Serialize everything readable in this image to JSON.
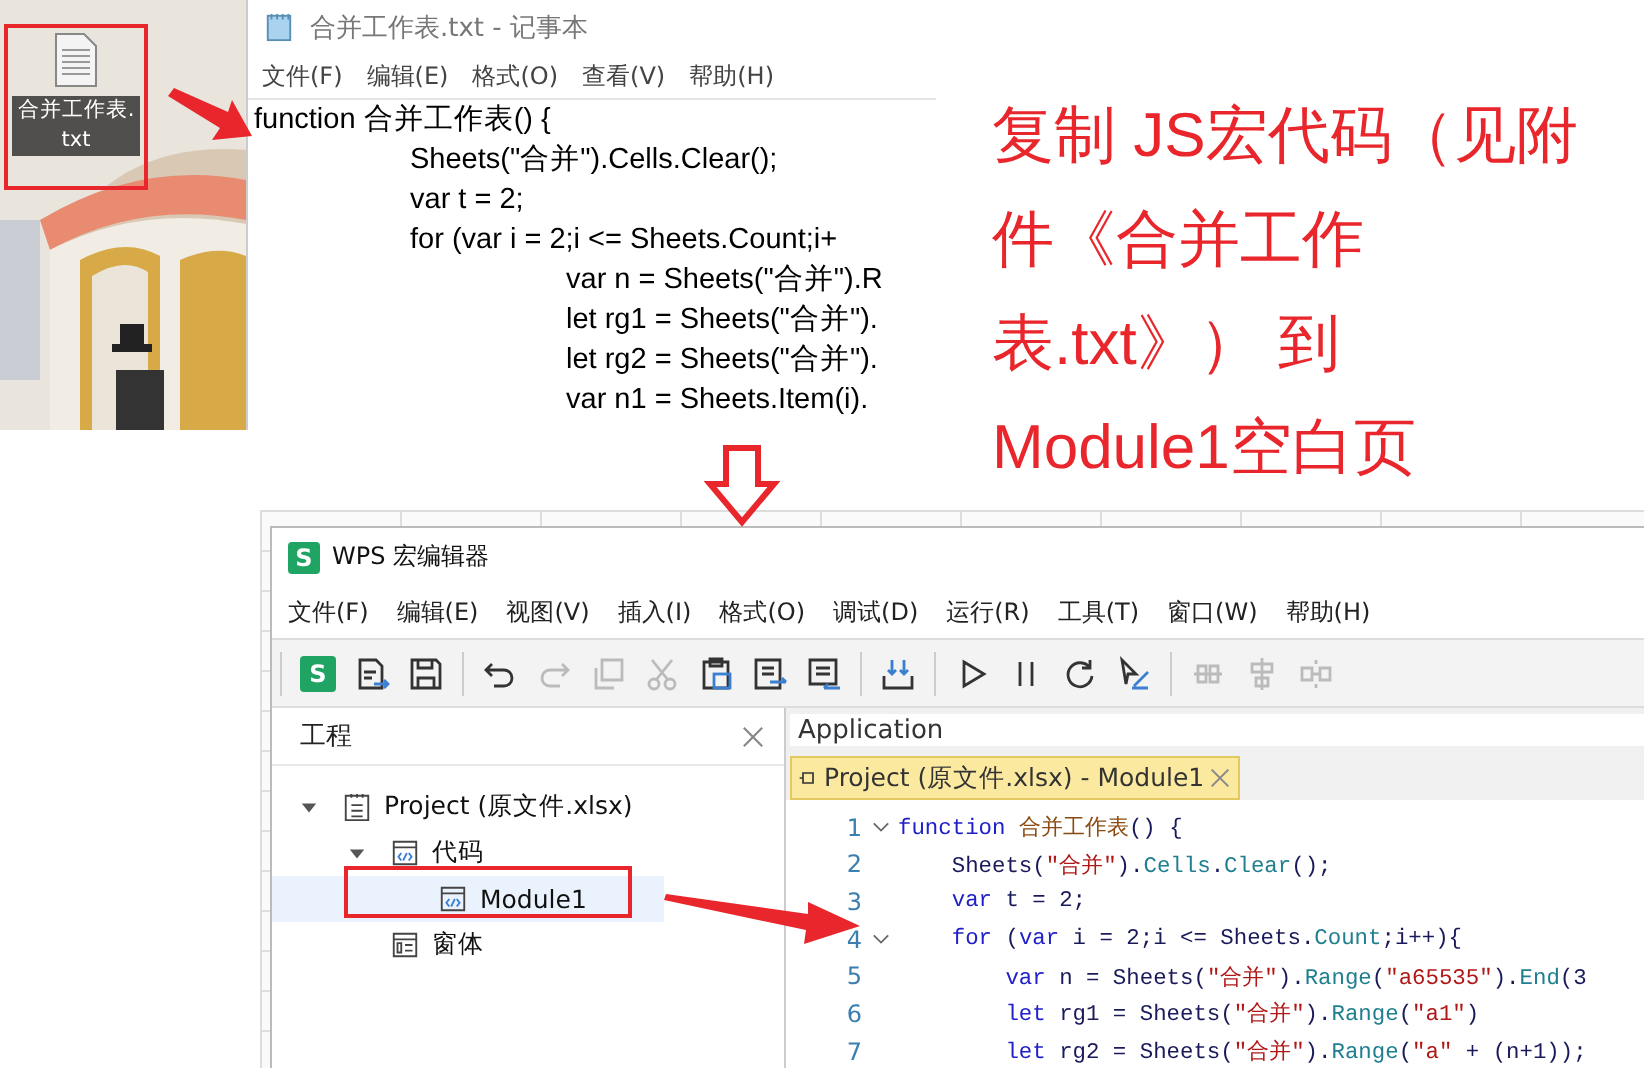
{
  "desktop": {
    "file_label": "合并工作表.txt"
  },
  "notepad": {
    "title": "合并工作表.txt - 记事本",
    "menu": [
      "文件(F)",
      "编辑(E)",
      "格式(O)",
      "查看(V)",
      "帮助(H)"
    ],
    "lines": [
      "function 合并工作表() {",
      "\t\tSheets(\"合并\").Cells.Clear();",
      "\t\tvar t = 2;",
      "\t\tfor (var i = 2;i <= Sheets.Count;i+",
      "\t\t\t\tvar n = Sheets(\"合并\").R",
      "\t\t\t\tlet rg1 = Sheets(\"合并\").",
      "\t\t\t\tlet rg2 = Sheets(\"合并\").",
      "\t\t\t\tvar n1 = Sheets.Item(i)."
    ]
  },
  "annotation": "复制 JS宏代码（见附件《合并工作表.txt》） 到 Module1空白页",
  "editor": {
    "logo_letter": "S",
    "title": "WPS 宏编辑器",
    "menu": [
      "文件(F)",
      "编辑(E)",
      "视图(V)",
      "插入(I)",
      "格式(O)",
      "调试(D)",
      "运行(R)",
      "工具(T)",
      "窗口(W)",
      "帮助(H)"
    ],
    "toolbar": [
      {
        "kind": "separator"
      },
      {
        "kind": "logo",
        "label": "S",
        "disabled": false
      },
      {
        "kind": "export",
        "disabled": false
      },
      {
        "kind": "save",
        "disabled": false
      },
      {
        "kind": "separator"
      },
      {
        "kind": "undo",
        "disabled": false
      },
      {
        "kind": "redo",
        "disabled": true
      },
      {
        "kind": "copy",
        "disabled": true
      },
      {
        "kind": "cut",
        "disabled": true
      },
      {
        "kind": "paste",
        "disabled": false
      },
      {
        "kind": "indent",
        "disabled": false
      },
      {
        "kind": "outdent",
        "disabled": false
      },
      {
        "kind": "separator"
      },
      {
        "kind": "import",
        "disabled": false
      },
      {
        "kind": "separator"
      },
      {
        "kind": "run",
        "disabled": false
      },
      {
        "kind": "pause",
        "disabled": false
      },
      {
        "kind": "reset",
        "disabled": false
      },
      {
        "kind": "design",
        "disabled": false
      },
      {
        "kind": "separator"
      },
      {
        "kind": "align",
        "disabled": true
      },
      {
        "kind": "center",
        "disabled": true
      },
      {
        "kind": "distribute",
        "disabled": true
      }
    ],
    "project_panel": {
      "title": "工程",
      "tree": [
        {
          "label": "Project (原文件.xlsx)",
          "kind": "project",
          "expanded": true,
          "selected": false,
          "children": [
            {
              "label": "代码",
              "kind": "code",
              "expanded": true,
              "selected": false,
              "children": [
                {
                  "label": "Module1",
                  "kind": "module",
                  "selected": true
                }
              ]
            },
            {
              "label": "窗体",
              "kind": "form",
              "selected": false
            }
          ]
        }
      ]
    },
    "object_field": {
      "value": "Application"
    },
    "tab": {
      "label": "Project (原文件.xlsx) - Module1",
      "selected": true
    },
    "code": [
      {
        "number": "1",
        "fold": true,
        "tokens": [
          {
            "text": "function",
            "kind": "keyword"
          },
          {
            "text": " 合并工作表",
            "kind": "name"
          },
          {
            "text": "() {",
            "kind": "plain"
          }
        ]
      },
      {
        "number": "2",
        "fold": false,
        "tokens": [
          {
            "text": "    Sheets(",
            "kind": "plain"
          },
          {
            "text": "\"合并\"",
            "kind": "string"
          },
          {
            "text": ").",
            "kind": "plain"
          },
          {
            "text": "Cells",
            "kind": "member"
          },
          {
            "text": ".",
            "kind": "plain"
          },
          {
            "text": "Clear",
            "kind": "member"
          },
          {
            "text": "();",
            "kind": "plain"
          }
        ]
      },
      {
        "number": "3",
        "fold": false,
        "tokens": [
          {
            "text": "    var",
            "kind": "keyword"
          },
          {
            "text": " t = 2;",
            "kind": "plain"
          }
        ]
      },
      {
        "number": "4",
        "fold": true,
        "tokens": [
          {
            "text": "    for",
            "kind": "keyword"
          },
          {
            "text": " (",
            "kind": "plain"
          },
          {
            "text": "var",
            "kind": "keyword"
          },
          {
            "text": " i = 2;i <= Sheets.",
            "kind": "plain"
          },
          {
            "text": "Count",
            "kind": "member"
          },
          {
            "text": ";i++){",
            "kind": "plain"
          }
        ]
      },
      {
        "number": "5",
        "fold": false,
        "tokens": [
          {
            "text": "        var",
            "kind": "keyword"
          },
          {
            "text": " n = Sheets(",
            "kind": "plain"
          },
          {
            "text": "\"合并\"",
            "kind": "string"
          },
          {
            "text": ").",
            "kind": "plain"
          },
          {
            "text": "Range",
            "kind": "member"
          },
          {
            "text": "(",
            "kind": "plain"
          },
          {
            "text": "\"a65535\"",
            "kind": "string"
          },
          {
            "text": ").",
            "kind": "plain"
          },
          {
            "text": "End",
            "kind": "member"
          },
          {
            "text": "(3",
            "kind": "plain"
          }
        ]
      },
      {
        "number": "6",
        "fold": false,
        "tokens": [
          {
            "text": "        let",
            "kind": "keyword"
          },
          {
            "text": " rg1 = Sheets(",
            "kind": "plain"
          },
          {
            "text": "\"合并\"",
            "kind": "string"
          },
          {
            "text": ").",
            "kind": "plain"
          },
          {
            "text": "Range",
            "kind": "member"
          },
          {
            "text": "(",
            "kind": "plain"
          },
          {
            "text": "\"a1\"",
            "kind": "string"
          },
          {
            "text": ")",
            "kind": "plain"
          }
        ]
      },
      {
        "number": "7",
        "fold": false,
        "tokens": [
          {
            "text": "        let",
            "kind": "keyword"
          },
          {
            "text": " rg2 = Sheets(",
            "kind": "plain"
          },
          {
            "text": "\"合并\"",
            "kind": "string"
          },
          {
            "text": ").",
            "kind": "plain"
          },
          {
            "text": "Range",
            "kind": "member"
          },
          {
            "text": "(",
            "kind": "plain"
          },
          {
            "text": "\"a\"",
            "kind": "string"
          },
          {
            "text": " + (n+1));",
            "kind": "plain"
          }
        ]
      }
    ]
  }
}
